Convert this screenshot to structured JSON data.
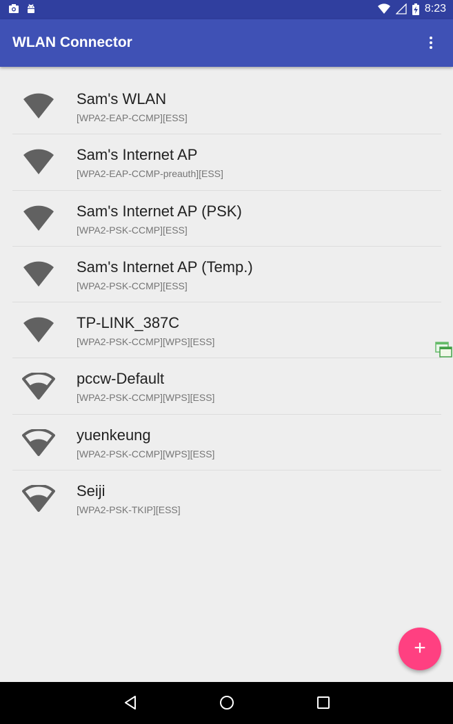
{
  "status_bar": {
    "time": "8:23",
    "icons": [
      "photo-icon",
      "android-icon",
      "wifi-signal-icon",
      "cell-signal-icon",
      "battery-charging-icon"
    ]
  },
  "app_bar": {
    "title": "WLAN Connector",
    "overflow_icon": "more-vert-icon"
  },
  "networks": [
    {
      "name": "Sam's WLAN",
      "capabilities": "[WPA2-EAP-CCMP][ESS]",
      "signal": "full"
    },
    {
      "name": "Sam's Internet AP",
      "capabilities": "[WPA2-EAP-CCMP-preauth][ESS]",
      "signal": "full"
    },
    {
      "name": "Sam's Internet AP (PSK)",
      "capabilities": "[WPA2-PSK-CCMP][ESS]",
      "signal": "full"
    },
    {
      "name": "Sam's Internet AP (Temp.)",
      "capabilities": "[WPA2-PSK-CCMP][ESS]",
      "signal": "full"
    },
    {
      "name": "TP-LINK_387C",
      "capabilities": "[WPA2-PSK-CCMP][WPS][ESS]",
      "signal": "full"
    },
    {
      "name": "pccw-Default",
      "capabilities": "[WPA2-PSK-CCMP][WPS][ESS]",
      "signal": "partial"
    },
    {
      "name": "yuenkeung",
      "capabilities": "[WPA2-PSK-CCMP][WPS][ESS]",
      "signal": "partial"
    },
    {
      "name": "Seiji",
      "capabilities": "[WPA2-PSK-TKIP][ESS]",
      "signal": "partial"
    }
  ],
  "fab": {
    "label": "+"
  },
  "nav_bar": {
    "icons": [
      "back-icon",
      "home-icon",
      "recents-icon"
    ]
  },
  "colors": {
    "status_bar": "#303f9f",
    "app_bar": "#3f51b5",
    "fab": "#ff4081",
    "icon": "#616161"
  }
}
